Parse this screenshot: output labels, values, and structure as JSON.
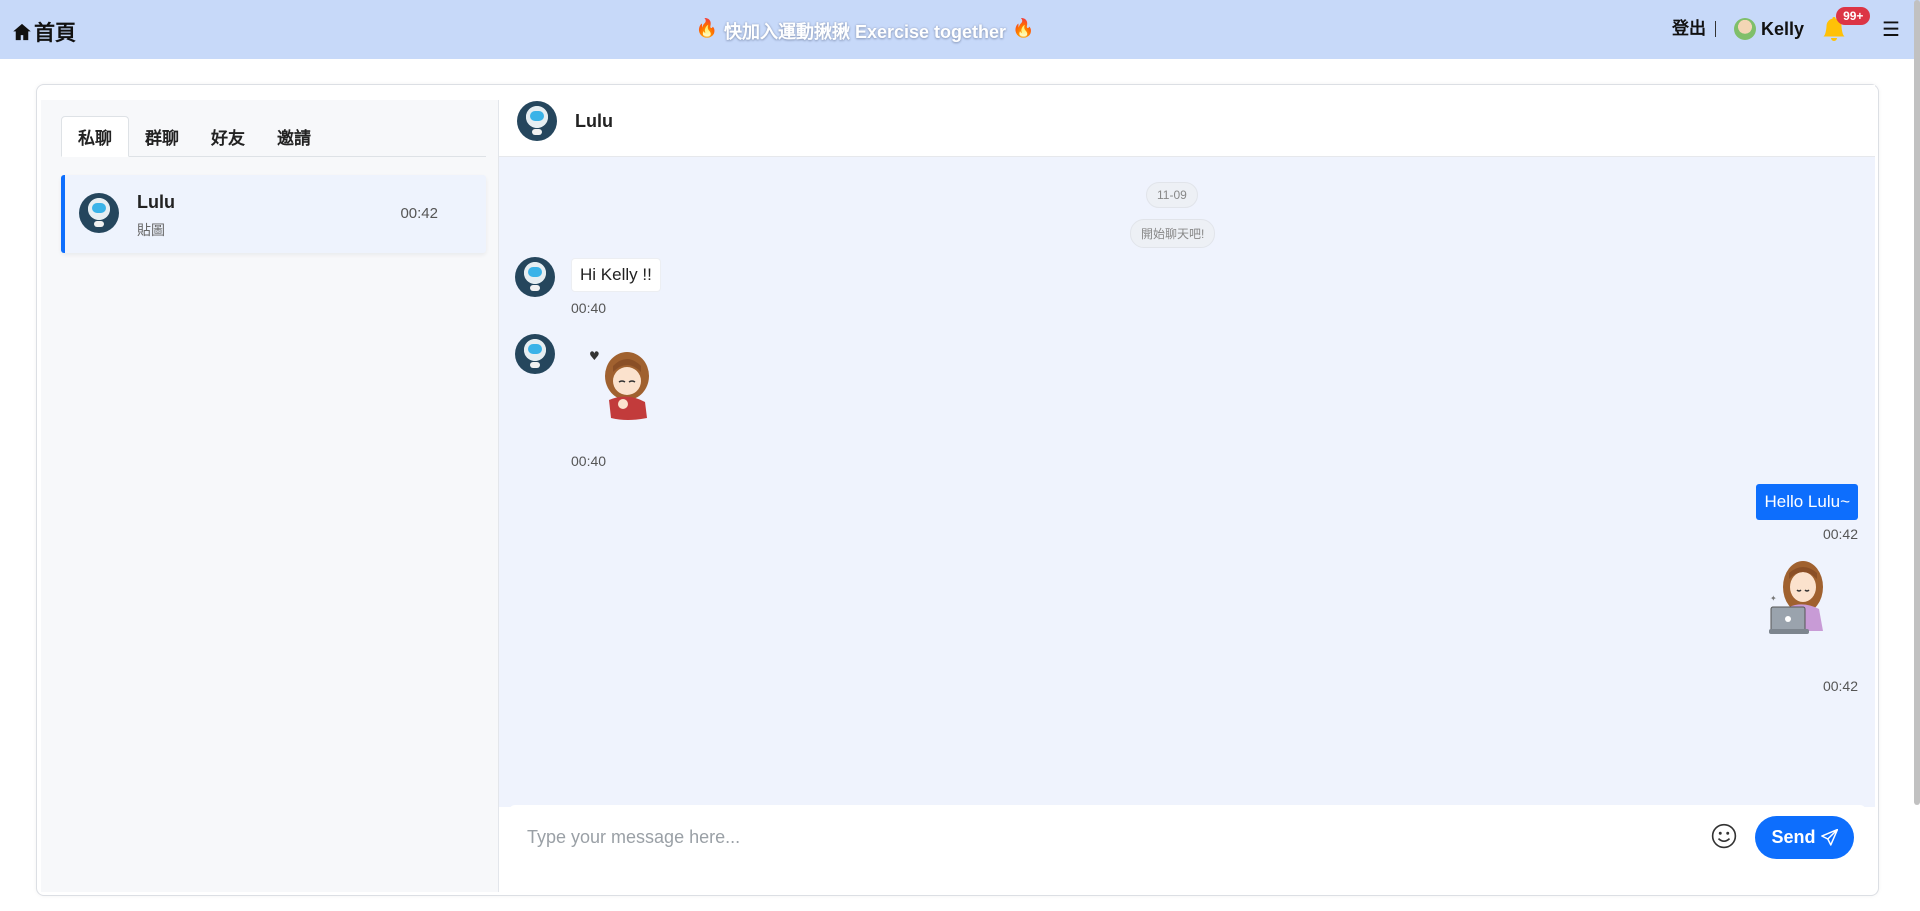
{
  "nav": {
    "home_label": "首頁",
    "banner_text": "快加入運動揪揪 Exercise together",
    "banner_icon": "fire-icon",
    "logout_label": "登出",
    "user_name": "Kelly",
    "notification_count": "99+",
    "menu_icon": "hamburger-icon"
  },
  "sidebar": {
    "tabs": [
      {
        "label": "私聊",
        "active": true
      },
      {
        "label": "群聊",
        "active": false
      },
      {
        "label": "好友",
        "active": false
      },
      {
        "label": "邀請",
        "active": false
      }
    ],
    "chats": [
      {
        "name": "Lulu",
        "preview": "貼圖",
        "time": "00:42",
        "selected": true
      }
    ]
  },
  "chat": {
    "contact_name": "Lulu",
    "date_label": "11-09",
    "system_message": "開始聊天吧!",
    "messages": [
      {
        "direction": "in",
        "type": "text",
        "text": "Hi Kelly !!",
        "time": "00:40"
      },
      {
        "direction": "in",
        "type": "sticker",
        "sticker": "girl-waving-sticker",
        "time": "00:40"
      },
      {
        "direction": "out",
        "type": "text",
        "text": "Hello Lulu~",
        "time": "00:42"
      },
      {
        "direction": "out",
        "type": "sticker",
        "sticker": "girl-laptop-sticker",
        "time": "00:42"
      }
    ],
    "input_placeholder": "Type your message here...",
    "input_value": "",
    "send_label": "Send"
  },
  "colors": {
    "navbar_bg": "#c7d9f9",
    "primary": "#0d6efd",
    "chat_bg": "#eff3fd",
    "badge": "#dc3545"
  }
}
